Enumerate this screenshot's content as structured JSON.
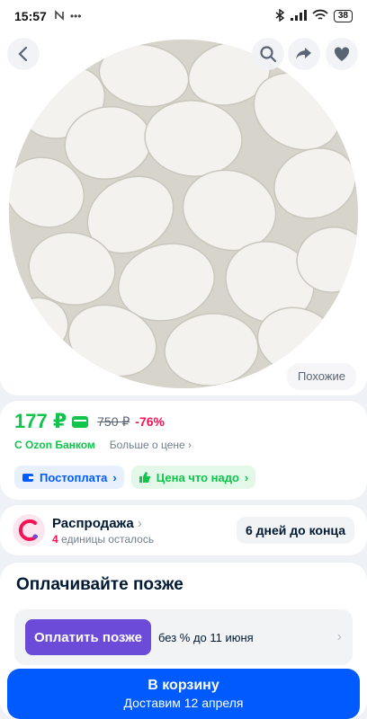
{
  "status_bar": {
    "time": "15:57",
    "battery": "38",
    "left_icons": [
      "nfc-icon",
      "more-dots-icon"
    ]
  },
  "product": {
    "similar_label": "Похожие"
  },
  "price": {
    "current": "177 ₽",
    "old": "750 ₽",
    "discount": "-76%",
    "bank_label": "С Ozon Банком",
    "more_label": "Больше о цене",
    "more_chevron": "›"
  },
  "badges": [
    {
      "label": "Постоплата",
      "chevron": "›",
      "color": "#005bff"
    },
    {
      "label": "Цена что надо",
      "chevron": "›",
      "color": "#10c44c"
    }
  ],
  "sale": {
    "title": "Распродажа",
    "title_chevron": "›",
    "count": "4",
    "remaining": "единицы осталось",
    "days": "6 дней до конца"
  },
  "pay_later": {
    "title": "Оплачивайте позже",
    "button": "Оплатить позже",
    "info": "без % до 11 июня",
    "chevron": "›"
  },
  "cart": {
    "label": "В корзину",
    "delivery": "Доставим 12 апреля"
  },
  "colors": {
    "accent": "#005bff",
    "price_green": "#10c44c",
    "discount": "#f91155",
    "paylater": "#6c4bd8"
  }
}
